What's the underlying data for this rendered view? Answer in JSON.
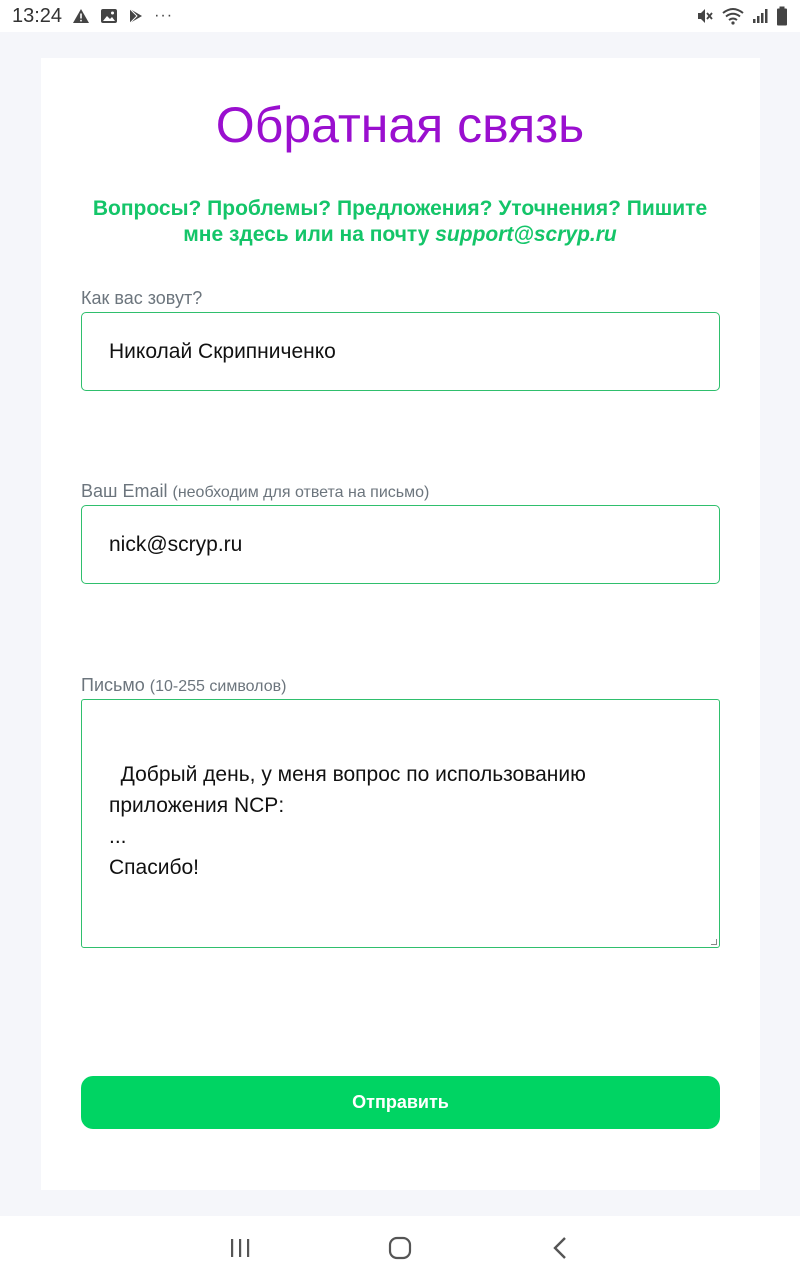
{
  "status_bar": {
    "time": "13:24",
    "left_icons": [
      "warning-icon",
      "image-icon",
      "play-store-icon",
      "more-icon"
    ],
    "right_icons": [
      "mute-icon",
      "wifi-icon",
      "signal-icon",
      "battery-icon"
    ],
    "more_glyph": "···"
  },
  "form": {
    "title": "Обратная связь",
    "subtitle": "Вопросы? Проблемы? Предложения? Уточнения? Пишите мне здесь или на почту",
    "subtitle_email": "support@scryp.ru",
    "name": {
      "label": "Как вас зовут?",
      "value": "Николай Скрипниченко"
    },
    "email": {
      "label": "Ваш Email",
      "hint": "(необходим для ответа на письмо)",
      "value": "nick@scryp.ru"
    },
    "message": {
      "label": "Письмо",
      "hint": "(10-255 символов)",
      "value": "Добрый день, у меня вопрос по использованию\nприложения NCP:\n...\nСпасибо!"
    },
    "submit_label": "Отправить"
  },
  "nav_bar": {
    "buttons": [
      "recent-apps-icon",
      "home-icon",
      "back-icon"
    ]
  },
  "colors": {
    "title": "#9a0fcf",
    "accent_green": "#14c569",
    "button": "#00d463",
    "input_border": "#2fbf6d",
    "page_bg": "#f5f6fa"
  }
}
